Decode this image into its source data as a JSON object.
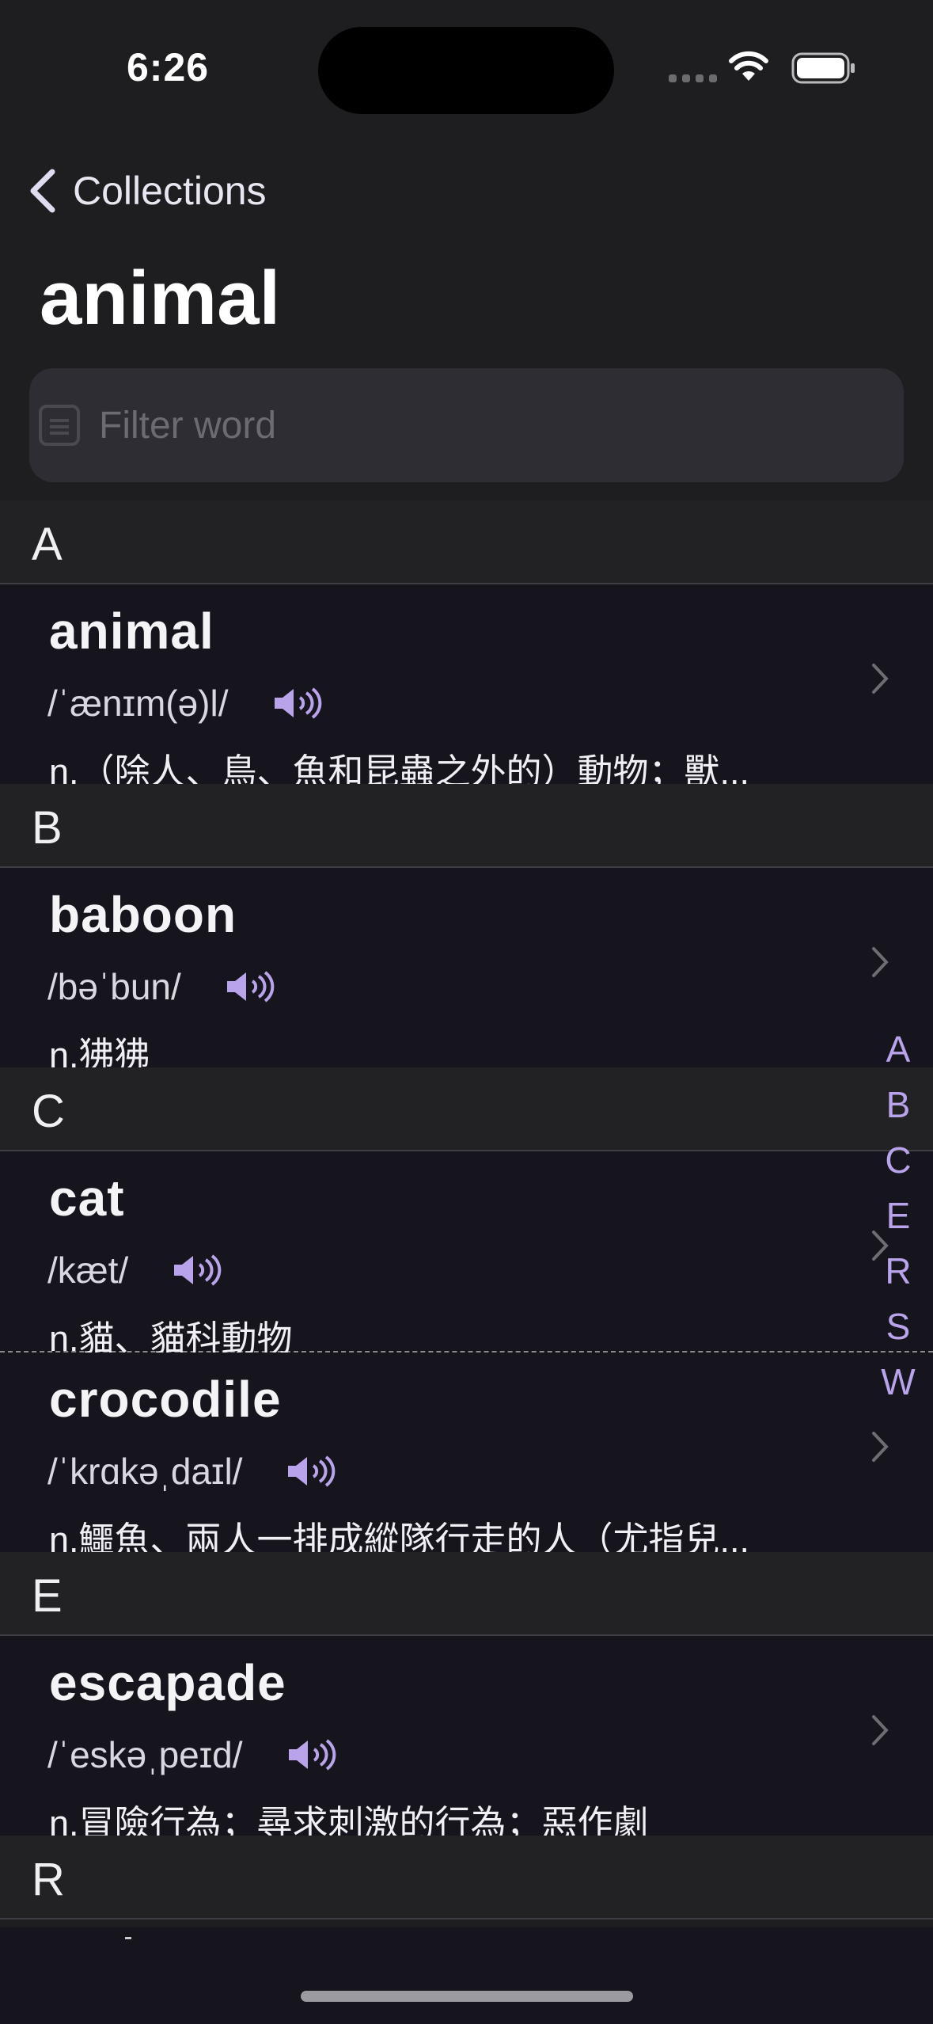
{
  "status": {
    "time": "6:26"
  },
  "nav": {
    "back_label": "Collections"
  },
  "title": "animal",
  "search": {
    "placeholder": "Filter word",
    "value": ""
  },
  "sections": [
    {
      "letter": "A",
      "words": [
        {
          "word": "animal",
          "phonetic": "/ˈænɪm(ə)l/",
          "definition": "n.（除人、鳥、魚和昆蟲之外的）動物；獸..."
        }
      ]
    },
    {
      "letter": "B",
      "words": [
        {
          "word": "baboon",
          "phonetic": "/bəˈbun/",
          "definition": "n.狒狒"
        }
      ]
    },
    {
      "letter": "C",
      "words": [
        {
          "word": "cat",
          "phonetic": "/kæt/",
          "definition": "n.貓、貓科動物"
        },
        {
          "word": "crocodile",
          "phonetic": "/ˈkrɑkəˌdaɪl/",
          "definition": "n.鱷魚、兩人一排成縱隊行走的人（尤指兒..."
        }
      ]
    },
    {
      "letter": "E",
      "words": [
        {
          "word": "escapade",
          "phonetic": "/ˈeskəˌpeɪd/",
          "definition": "n.冒險行為；尋求刺激的行為；惡作劇"
        }
      ]
    },
    {
      "letter": "R",
      "words": []
    }
  ],
  "index": [
    "A",
    "B",
    "C",
    "E",
    "R",
    "S",
    "W"
  ],
  "colors": {
    "accent": "#b9a3ea",
    "background": "#1e1e20",
    "row_background": "#16141d"
  }
}
